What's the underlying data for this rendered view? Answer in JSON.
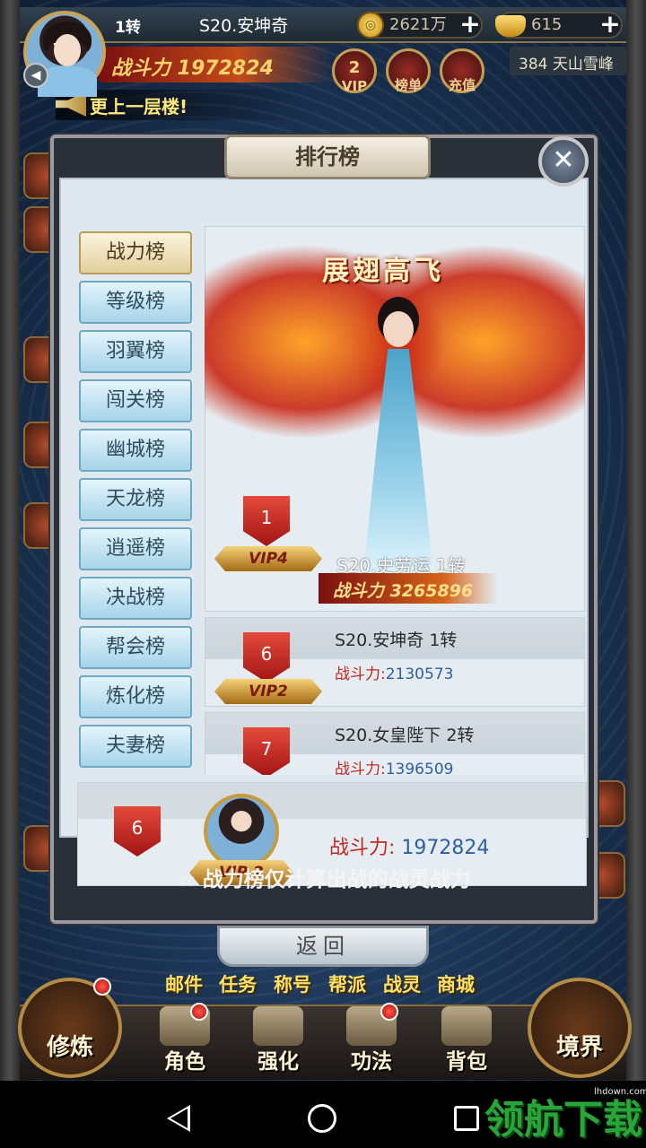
{
  "header": {
    "rebirth": "1转",
    "server_name": "S20.安坤奇",
    "gold": "2621万",
    "ingot": "615",
    "combat_power": "战斗力 1972824",
    "location": "384 天山雪峰",
    "vip_btn_level": "2",
    "vip_btn_label": "VIP",
    "rank_btn_label": "榜单",
    "recharge_btn_label": "充值"
  },
  "notice": "更上一层楼!",
  "modal": {
    "title": "排行榜",
    "close": "✕",
    "tabs": [
      "战力榜",
      "等级榜",
      "羽翼榜",
      "闯关榜",
      "幽城榜",
      "天龙榜",
      "逍遥榜",
      "决战榜",
      "帮会榜",
      "炼化榜",
      "夫妻榜"
    ],
    "wings_title": "展翅高飞",
    "top1": {
      "rank": "1",
      "vip": "VIP4",
      "name": "S20.史劳运 1转",
      "power": "战斗力 3265896"
    },
    "rows": [
      {
        "rank": "6",
        "vip": "VIP2",
        "name": "S20.安坤奇  1转",
        "power_label": "战斗力:",
        "power": "2130573"
      },
      {
        "rank": "7",
        "vip": "",
        "name": "S20.女皇陛下  2转",
        "power_label": "战斗力:",
        "power": "1396509"
      }
    ],
    "mine": {
      "rank": "6",
      "vip": "VIP 2",
      "power_label": "战斗力: ",
      "power": "1972824"
    },
    "footnote": "☆ 战力榜仅计算出战的战灵战力"
  },
  "back_button": "返回",
  "quick_links": [
    "邮件",
    "任务",
    "称号",
    "帮派",
    "战灵",
    "商城"
  ],
  "dock": {
    "left_big": "修炼",
    "items": [
      "角色",
      "强化",
      "功法",
      "背包"
    ],
    "right_big": "境界"
  },
  "watermark": "领航下载",
  "watermark_small": "lhdown.com"
}
